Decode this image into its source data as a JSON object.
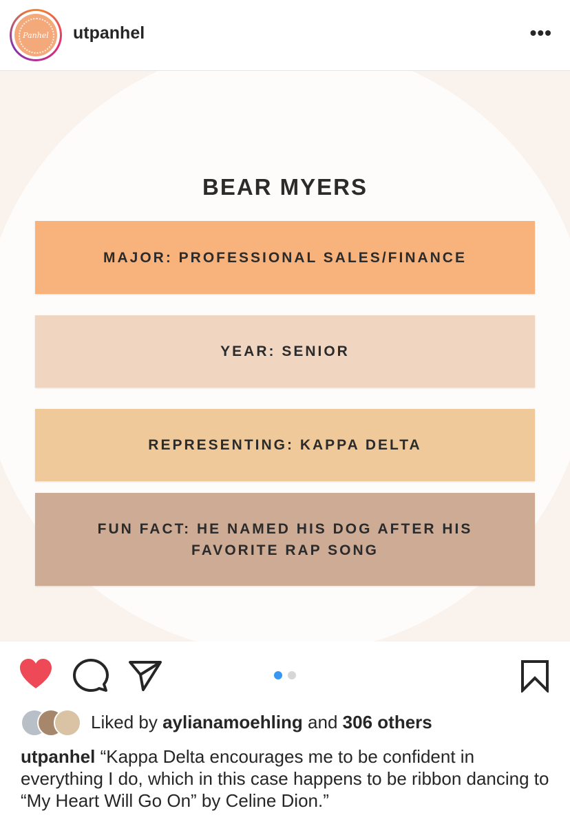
{
  "header": {
    "username": "utpanhel",
    "avatar_text": "Panhel",
    "more_label": "•••"
  },
  "post": {
    "title": "BEAR MYERS",
    "boxes": [
      {
        "text": "MAJOR: PROFESSIONAL SALES/FINANCE",
        "color": "#f8b37c"
      },
      {
        "text": "YEAR: SENIOR",
        "color": "#f0d5c1"
      },
      {
        "text": "REPRESENTING: KAPPA DELTA",
        "color": "#f0c99a"
      },
      {
        "text_line1": "FUN FACT: HE NAMED HIS DOG AFTER HIS",
        "text_line2": "FAVORITE RAP SONG",
        "color": "#cdab95"
      }
    ]
  },
  "actions": {
    "icons": [
      "heart-icon",
      "comment-icon",
      "share-icon",
      "bookmark-icon"
    ],
    "liked": true,
    "carousel_total": 2,
    "carousel_active": 1,
    "colors": {
      "heart": "#ed4956",
      "active_dot": "#3897f0"
    }
  },
  "likes": {
    "prefix": "Liked by",
    "user": "aylianamoehling",
    "conjunction": "and",
    "others": "306 others"
  },
  "caption": {
    "username": "utpanhel",
    "text": "“Kappa Delta encourages me to be confident in everything I do, which in this case happens to be ribbon dancing to “My Heart Will Go On” by Celine Dion.”"
  }
}
